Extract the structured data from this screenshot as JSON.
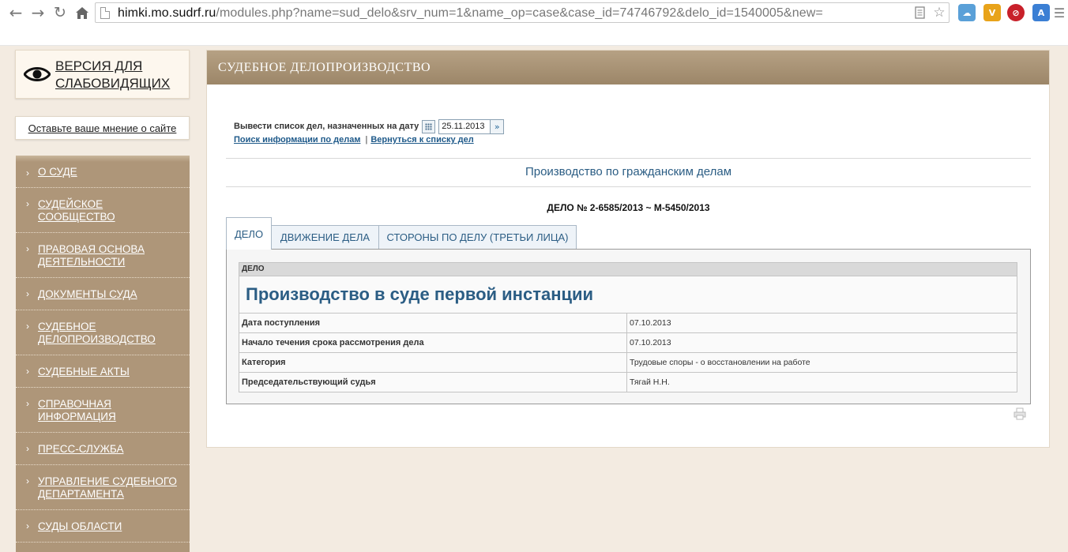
{
  "browser": {
    "url_host": "himki.mo.sudrf.ru",
    "url_path": "/modules.php?name=sud_delo&srv_num=1&name_op=case&case_id=74746792&delo_id=1540005&new="
  },
  "sidebar": {
    "low_vision_label": "ВЕРСИЯ ДЛЯ СЛАБОВИДЯЩИХ",
    "feedback_label": "Оставьте ваше мнение о сайте",
    "menu": [
      {
        "line1": "О СУДЕ",
        "line2": ""
      },
      {
        "line1": "СУДЕЙСКОЕ",
        "line2": "СООБЩЕСТВО"
      },
      {
        "line1": "ПРАВОВАЯ ОСНОВА",
        "line2": "ДЕЯТЕЛЬНОСТИ"
      },
      {
        "line1": "ДОКУМЕНТЫ СУДА",
        "line2": ""
      },
      {
        "line1": "СУДЕБНОЕ",
        "line2": "ДЕЛОПРОИЗВОДСТВО"
      },
      {
        "line1": "СУДЕБНЫЕ АКТЫ",
        "line2": ""
      },
      {
        "line1": "СПРАВОЧНАЯ",
        "line2": "ИНФОРМАЦИЯ"
      },
      {
        "line1": "ПРЕСС-СЛУЖБА",
        "line2": ""
      },
      {
        "line1": "УПРАВЛЕНИЕ СУДЕБНОГО",
        "line2": "ДЕПАРТАМЕНТА"
      },
      {
        "line1": "СУДЫ ОБЛАСТИ",
        "line2": ""
      }
    ]
  },
  "content": {
    "header": "СУДЕБНОЕ ДЕЛОПРОИЗВОДСТВО",
    "date_label": "Вывести список дел, назначенных на дату",
    "date_value": "25.11.2013",
    "link_search": "Поиск информации по делам",
    "link_separator": "|",
    "link_back": "Вернуться к списку дел",
    "section_title": "Производство по гражданским делам",
    "case_number": "ДЕЛО № 2-6585/2013 ~ М-5450/2013",
    "tabs": [
      {
        "label": "ДЕЛО"
      },
      {
        "label": "ДВИЖЕНИЕ ДЕЛА"
      },
      {
        "label": "СТОРОНЫ ПО ДЕЛУ (ТРЕТЬИ ЛИЦА)"
      }
    ],
    "table": {
      "caption": "ДЕЛО",
      "heading": "Производство в суде первой инстанции",
      "rows": [
        {
          "key": "Дата поступления",
          "value": "07.10.2013"
        },
        {
          "key": "Начало течения срока рассмотрения дела",
          "value": "07.10.2013"
        },
        {
          "key": "Категория",
          "value": "Трудовые споры - о восстановлении на работе"
        },
        {
          "key": "Председательствующий судья",
          "value": "Тягай Н.Н."
        }
      ]
    }
  },
  "colors": {
    "menu_bg": "#ae9679",
    "header_bg": "#a68f71",
    "accent_blue": "#2b5d84",
    "page_bg": "#f3ebe1"
  }
}
